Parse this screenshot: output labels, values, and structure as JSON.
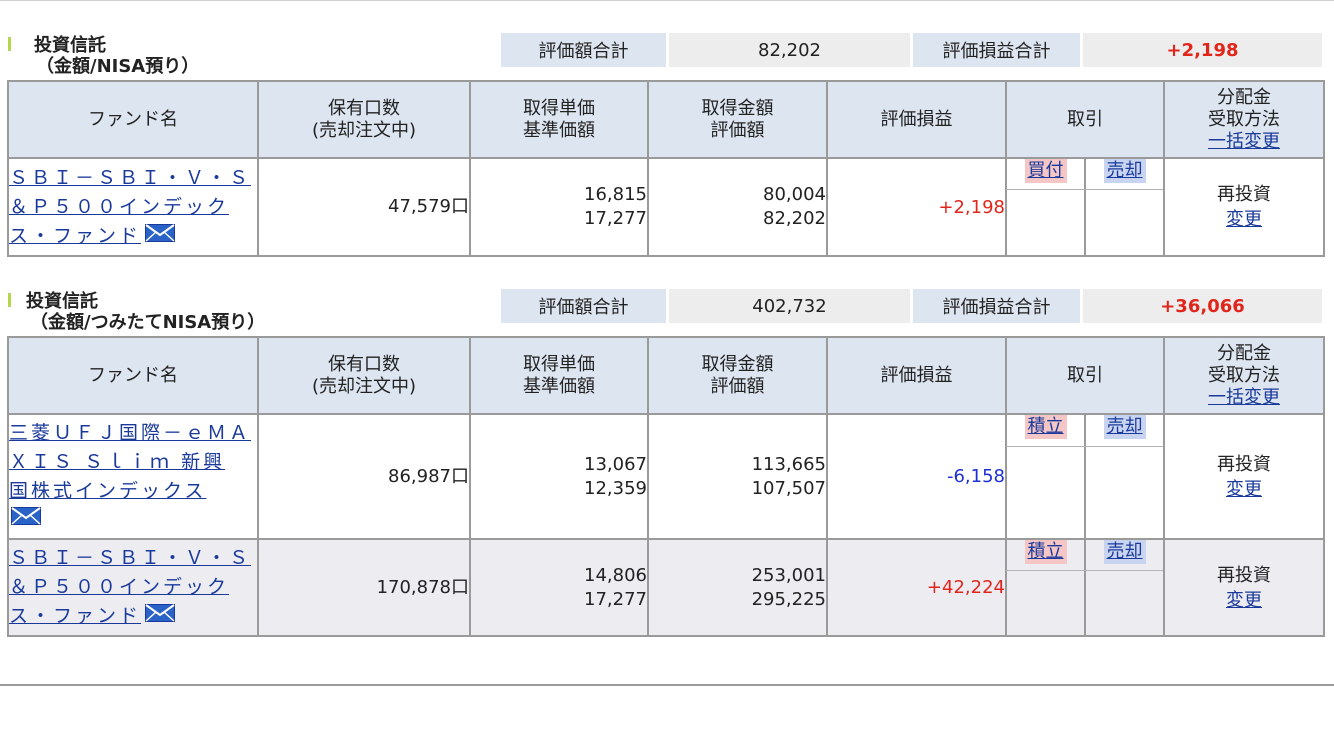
{
  "sections": [
    {
      "title_line1": "投資信託",
      "title_line2": "（金額/NISA預り）",
      "total_value_label": "評価額合計",
      "total_value": "82,202",
      "total_pl_label": "評価損益合計",
      "total_pl": "+2,198",
      "headers": {
        "fund_name": "ファンド名",
        "holdings_l1": "保有口数",
        "holdings_l2": "(売却注文中)",
        "unit_price_l1": "取得単価",
        "unit_price_l2": "基準価額",
        "amount_l1": "取得金額",
        "amount_l2": "評価額",
        "pl": "評価損益",
        "trade": "取引",
        "dist_l1": "分配金",
        "dist_l2": "受取方法",
        "dist_link": "一括変更"
      },
      "rows": [
        {
          "name_l1": "ＳＢＩ－ＳＢＩ・Ｖ・Ｓ",
          "name_l2": "＆Ｐ５００インデック",
          "name_l3": "ス・ファンド",
          "units": "47,579口",
          "acq_price": "16,815",
          "base_price": "17,277",
          "acq_amount": "80,004",
          "eval_amount": "82,202",
          "pl": "+2,198",
          "trade_buy": "買付",
          "trade_sell": "売却",
          "dist_method": "再投資",
          "dist_change": "変更"
        }
      ]
    },
    {
      "title_line1": "投資信託",
      "title_line2": "（金額/つみたてNISA預り）",
      "total_value_label": "評価額合計",
      "total_value": "402,732",
      "total_pl_label": "評価損益合計",
      "total_pl": "+36,066",
      "headers": {
        "fund_name": "ファンド名",
        "holdings_l1": "保有口数",
        "holdings_l2": "(売却注文中)",
        "unit_price_l1": "取得単価",
        "unit_price_l2": "基準価額",
        "amount_l1": "取得金額",
        "amount_l2": "評価額",
        "pl": "評価損益",
        "trade": "取引",
        "dist_l1": "分配金",
        "dist_l2": "受取方法",
        "dist_link": "一括変更"
      },
      "rows": [
        {
          "name_l1": "三菱ＵＦＪ国際－ｅＭＡ",
          "name_l2": "ＸＩＳ Ｓｌｉｍ 新興",
          "name_l3": "国株式インデックス",
          "units": "86,987口",
          "acq_price": "13,067",
          "base_price": "12,359",
          "acq_amount": "113,665",
          "eval_amount": "107,507",
          "pl": "-6,158",
          "trade_buy": "積立",
          "trade_sell": "売却",
          "dist_method": "再投資",
          "dist_change": "変更"
        },
        {
          "name_l1": "ＳＢＩ－ＳＢＩ・Ｖ・Ｓ",
          "name_l2": "＆Ｐ５００インデック",
          "name_l3": "ス・ファンド",
          "units": "170,878口",
          "acq_price": "14,806",
          "base_price": "17,277",
          "acq_amount": "253,001",
          "eval_amount": "295,225",
          "pl": "+42,224",
          "trade_buy": "積立",
          "trade_sell": "売却",
          "dist_method": "再投資",
          "dist_change": "変更"
        }
      ]
    }
  ],
  "icons": {
    "mail": "mail-icon"
  },
  "colors": {
    "positive": "#e1251b",
    "negative": "#1e2fd4",
    "header_bg": "#dde5f0",
    "link": "#1a3a9b"
  }
}
